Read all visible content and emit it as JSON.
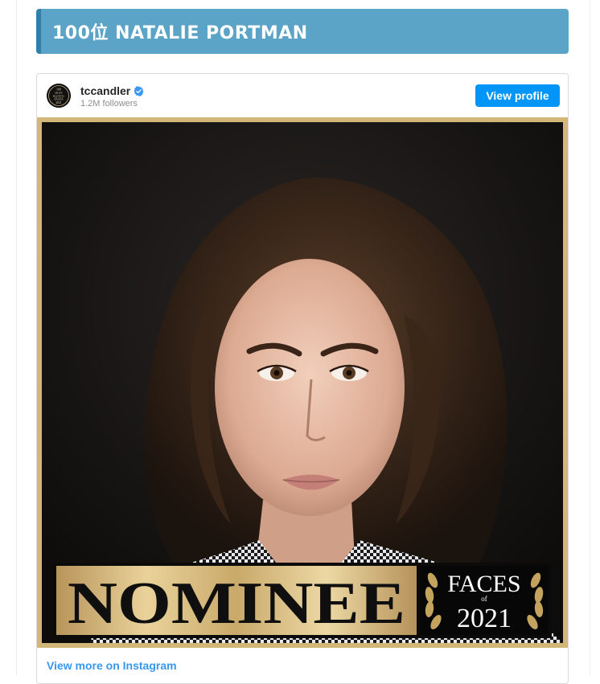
{
  "rank_banner": {
    "title": "100位 NATALIE PORTMAN"
  },
  "embed": {
    "username": "tccandler",
    "followers": "1.2M followers",
    "view_profile_label": "View profile",
    "view_more_label": "View more on Instagram",
    "avatar_text": [
      "100",
      "MOST",
      "BEAUTIFUL",
      "FACES",
      "2021"
    ],
    "photo": {
      "nominee_text": "NOMINEE",
      "faces_text": "FACES",
      "of_text": "of",
      "year_text": "2021"
    }
  },
  "colors": {
    "banner": "#5ba4c8",
    "banner_accent": "#2f7fa8",
    "button": "#0095f6",
    "link": "#3897f0",
    "gold_frame": "#d2b779"
  },
  "icons": {
    "verified": "verified-badge-icon",
    "laurel": "laurel-wreath-icon"
  }
}
